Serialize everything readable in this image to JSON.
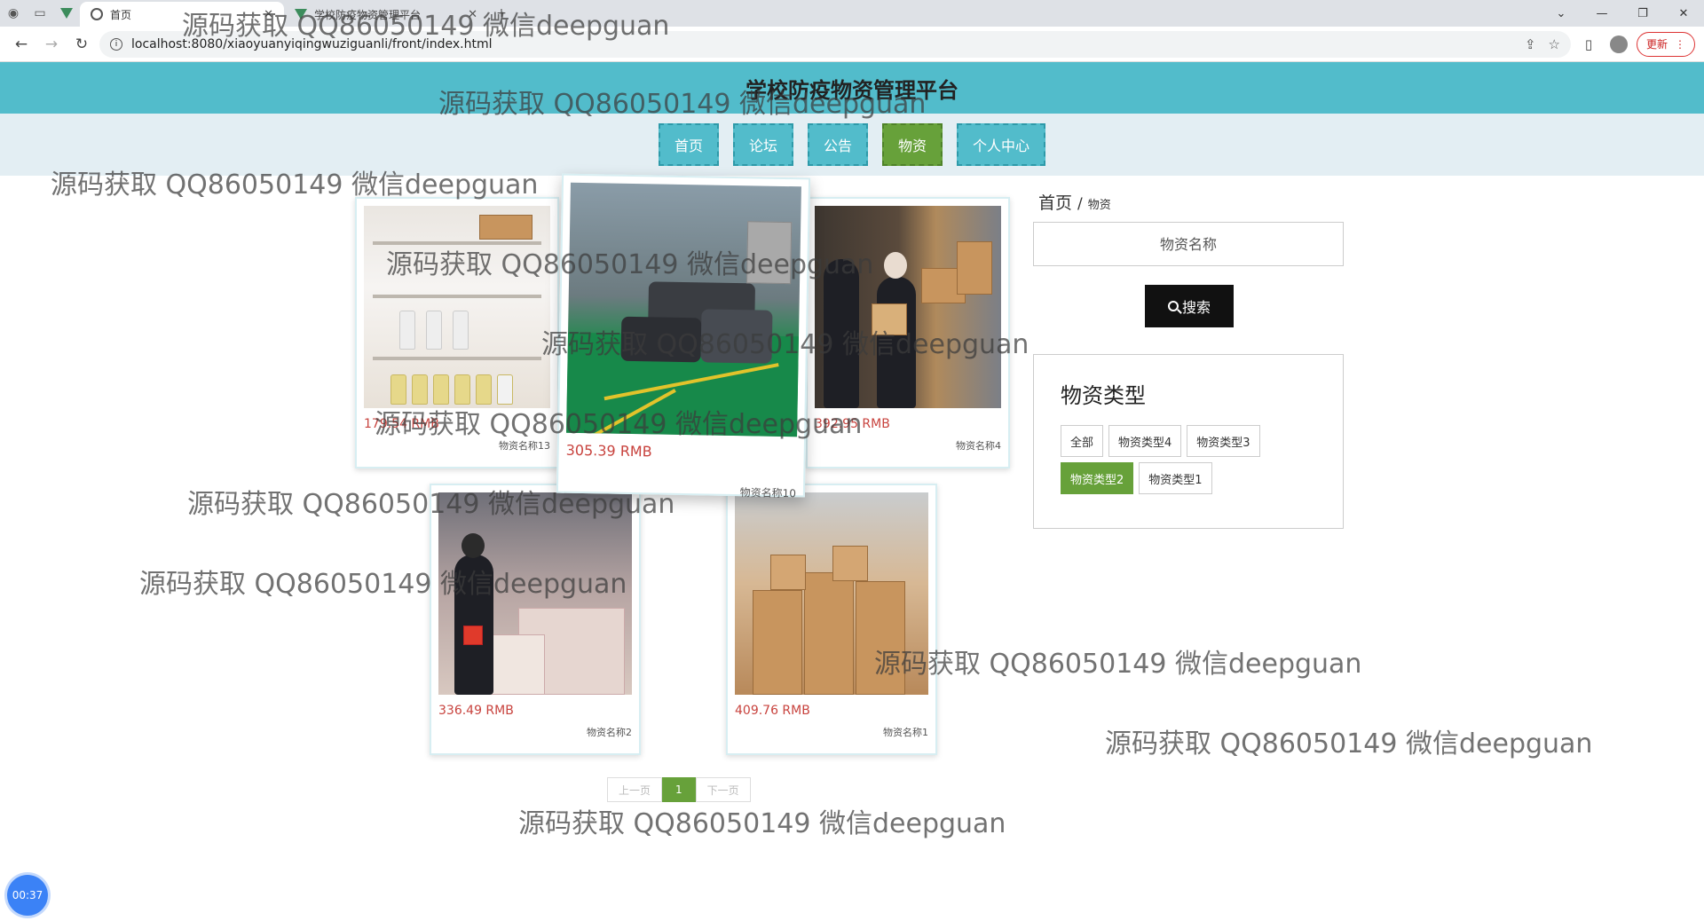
{
  "browser": {
    "tabs": [
      {
        "title": "首页",
        "active": true
      },
      {
        "title": "学校防疫物资管理平台",
        "active": false
      }
    ],
    "url": "localhost:8080/xiaoyuanyiqingwuziguanli/front/index.html",
    "update_label": "更新"
  },
  "site": {
    "title": "学校防疫物资管理平台",
    "nav": [
      {
        "label": "首页",
        "active": false
      },
      {
        "label": "论坛",
        "active": false
      },
      {
        "label": "公告",
        "active": false
      },
      {
        "label": "物资",
        "active": true
      },
      {
        "label": "个人中心",
        "active": false
      }
    ]
  },
  "products": [
    {
      "price": "179.54 RMB",
      "name": "物资名称13"
    },
    {
      "price": "305.39 RMB",
      "name": "物资名称10"
    },
    {
      "price": "392.95 RMB",
      "name": "物资名称4"
    },
    {
      "price": "336.49 RMB",
      "name": "物资名称2"
    },
    {
      "price": "409.76 RMB",
      "name": "物资名称1"
    }
  ],
  "sidebar": {
    "breadcrumb_home": "首页",
    "breadcrumb_sep": "/",
    "breadcrumb_current": "物资",
    "search_placeholder": "物资名称",
    "search_label": "搜索",
    "category_title": "物资类型",
    "categories": [
      {
        "label": "全部",
        "active": false
      },
      {
        "label": "物资类型4",
        "active": false
      },
      {
        "label": "物资类型3",
        "active": false
      },
      {
        "label": "物资类型2",
        "active": true
      },
      {
        "label": "物资类型1",
        "active": false
      }
    ]
  },
  "pagination": {
    "prev": "上一页",
    "current": "1",
    "next": "下一页"
  },
  "timer": "00:37",
  "watermark": "源码获取 QQ86050149 微信deepguan"
}
